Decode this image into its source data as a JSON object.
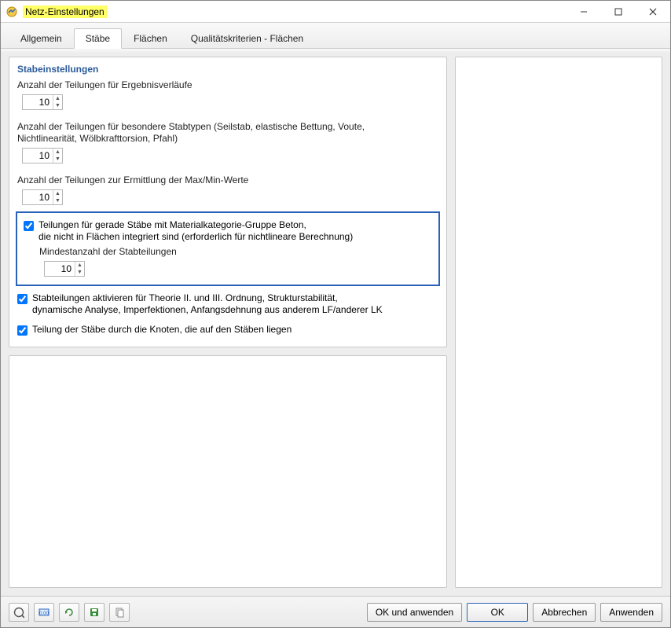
{
  "window": {
    "title": "Netz-Einstellungen"
  },
  "tabs": {
    "general": "Allgemein",
    "members": "Stäbe",
    "surfaces": "Flächen",
    "quality": "Qualitätskriterien - Flächen"
  },
  "section": {
    "title": "Stabeinstellungen",
    "div_results_label": "Anzahl der Teilungen für Ergebnisverläufe",
    "div_results_value": "10",
    "div_special_label": "Anzahl der Teilungen für besondere Stabtypen (Seilstab, elastische Bettung, Voute, Nichtlinearität, Wölbkrafttorsion, Pfahl)",
    "div_special_value": "10",
    "div_maxmin_label": "Anzahl der Teilungen zur Ermittlung der Max/Min-Werte",
    "div_maxmin_value": "10",
    "concrete_checkbox_label_line1": "Teilungen für gerade Stäbe mit Materialkategorie-Gruppe Beton,",
    "concrete_checkbox_label_line2": "die nicht in Flächen integriert sind (erforderlich für nichtlineare Berechnung)",
    "concrete_min_label": "Mindestanzahl der Stabteilungen",
    "concrete_min_value": "10",
    "activate_divisions_label_line1": "Stabteilungen aktivieren für Theorie II. und III. Ordnung, Strukturstabilität,",
    "activate_divisions_label_line2": "dynamische Analyse, Imperfektionen, Anfangsdehnung aus anderem LF/anderer LK",
    "divide_by_nodes_label": "Teilung der Stäbe durch die Knoten, die auf den Stäben liegen"
  },
  "footer": {
    "ok_apply": "OK und anwenden",
    "ok": "OK",
    "cancel": "Abbrechen",
    "apply": "Anwenden"
  }
}
